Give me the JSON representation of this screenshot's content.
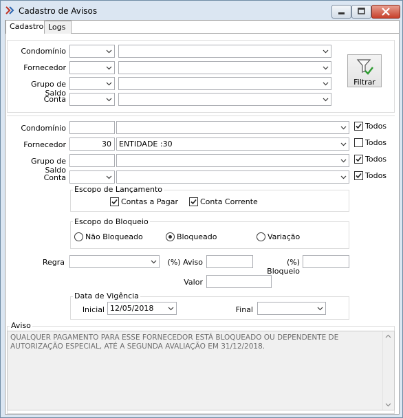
{
  "window": {
    "title": "Cadastro de Avisos"
  },
  "tabs": [
    {
      "label": "Cadastro"
    },
    {
      "label": "Logs"
    }
  ],
  "filter": {
    "condominio_label": "Condomínio",
    "fornecedor_label": "Fornecedor",
    "grupo_label": "Grupo de Saldo",
    "conta_label": "Conta",
    "button_label": "Filtrar"
  },
  "form": {
    "condominio": {
      "label": "Condomínio",
      "code": "",
      "name": "",
      "todos": "Todos",
      "todos_checked": true
    },
    "fornecedor": {
      "label": "Fornecedor",
      "code": "30",
      "name": "ENTIDADE :30",
      "todos": "Todos",
      "todos_checked": false
    },
    "grupo": {
      "label": "Grupo de Saldo",
      "code": "",
      "name": "",
      "todos": "Todos",
      "todos_checked": true
    },
    "conta": {
      "label": "Conta",
      "code": "",
      "name": "",
      "todos": "Todos",
      "todos_checked": true
    }
  },
  "escopo_lancamento": {
    "title": "Escopo de Lançamento",
    "contas_pagar": "Contas a Pagar",
    "contas_pagar_checked": true,
    "conta_corrente": "Conta Corrente",
    "conta_corrente_checked": true
  },
  "escopo_bloqueio": {
    "title": "Escopo do Bloqueio",
    "options": [
      "Não Bloqueado",
      "Bloqueado",
      "Variação"
    ],
    "selected": "Bloqueado"
  },
  "regra": {
    "label": "Regra",
    "value": "",
    "aviso_label": "(%) Aviso",
    "aviso_value": "",
    "bloqueio_label": "(%) Bloqueio",
    "bloqueio_value": "",
    "valor_label": "Valor",
    "valor_value": ""
  },
  "vigencia": {
    "title": "Data de Vigência",
    "inicial_label": "Inicial",
    "inicial_value": "12/05/2018",
    "final_label": "Final",
    "final_value": ""
  },
  "aviso": {
    "title": "Aviso",
    "text": "QUALQUER PAGAMENTO PARA ESSE FORNECEDOR ESTÁ BLOQUEADO OU DEPENDENTE DE AUTORIZAÇÃO ESPECIAL, ATÉ A SEGUNDA AVALIAÇÃO EM 31/12/2018."
  },
  "icons": {
    "app": "app-icon",
    "filter": "funnel-check-icon",
    "dropdown": "chevron-down-icon"
  }
}
